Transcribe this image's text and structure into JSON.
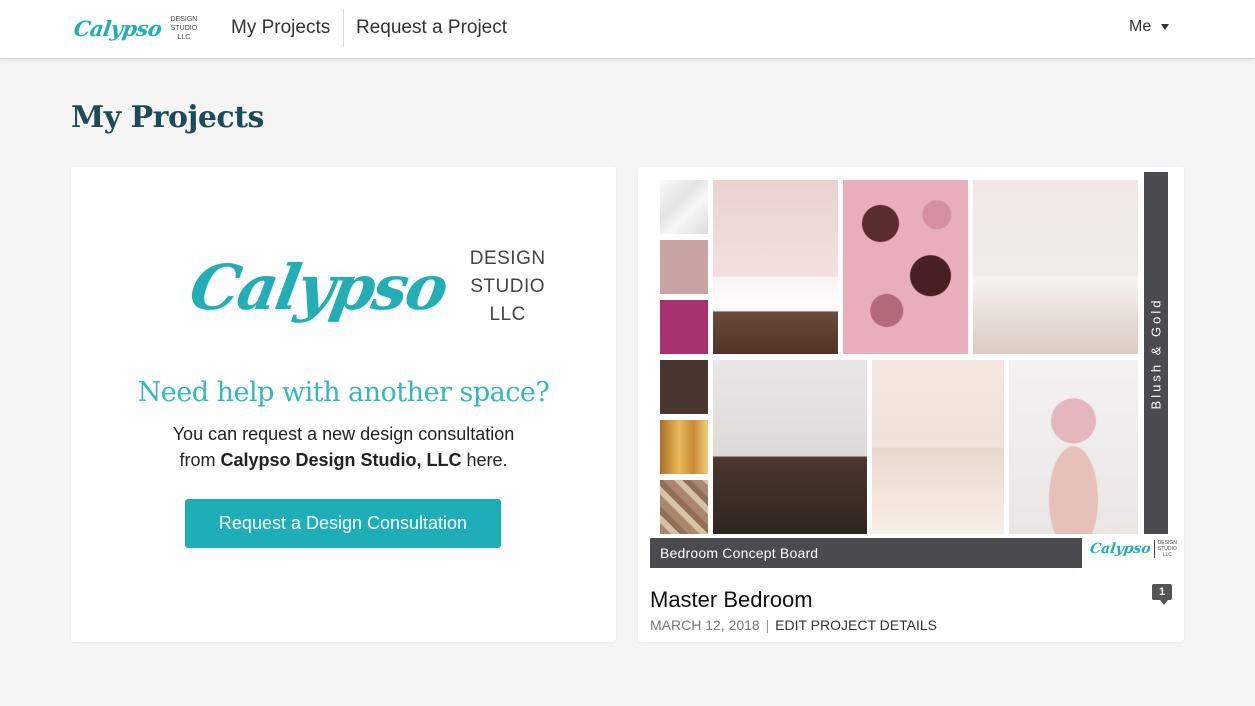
{
  "nav": {
    "logo_script": "Calypso",
    "logo_line1": "DESIGN",
    "logo_line2": "STUDIO",
    "logo_line3": "LLC",
    "my_projects": "My Projects",
    "request_project": "Request a Project",
    "user_menu": "Me"
  },
  "page": {
    "title": "My Projects"
  },
  "promo": {
    "logo_script": "Calypso",
    "logo_line1": "DESIGN",
    "logo_line2": "STUDIO",
    "logo_line3": "LLC",
    "heading": "Need help with another space?",
    "text_line1": "You can request a new design consultation",
    "text_from": "from ",
    "text_company": "Calypso Design Studio, LLC",
    "text_here": " here.",
    "button_label": "Request a Design Consultation"
  },
  "project": {
    "board_label": "Bedroom Concept Board",
    "board_side_text": "Blush & Gold",
    "board_logo_script": "Calypso",
    "board_logo_line1": "DESIGN",
    "board_logo_line2": "STUDIO",
    "board_logo_line3": "LLC",
    "name": "Master Bedroom",
    "date": "MARCH 12, 2018",
    "separator": "|",
    "edit_link": "EDIT PROJECT DETAILS",
    "comment_count": "1"
  },
  "colors": {
    "brand_teal": "#1eaeb8",
    "title_navy": "#1c4a56",
    "board_gray": "#4a4a4f"
  },
  "icons": {
    "user_menu_caret": "chevron-down-icon",
    "comment": "comment-icon"
  }
}
